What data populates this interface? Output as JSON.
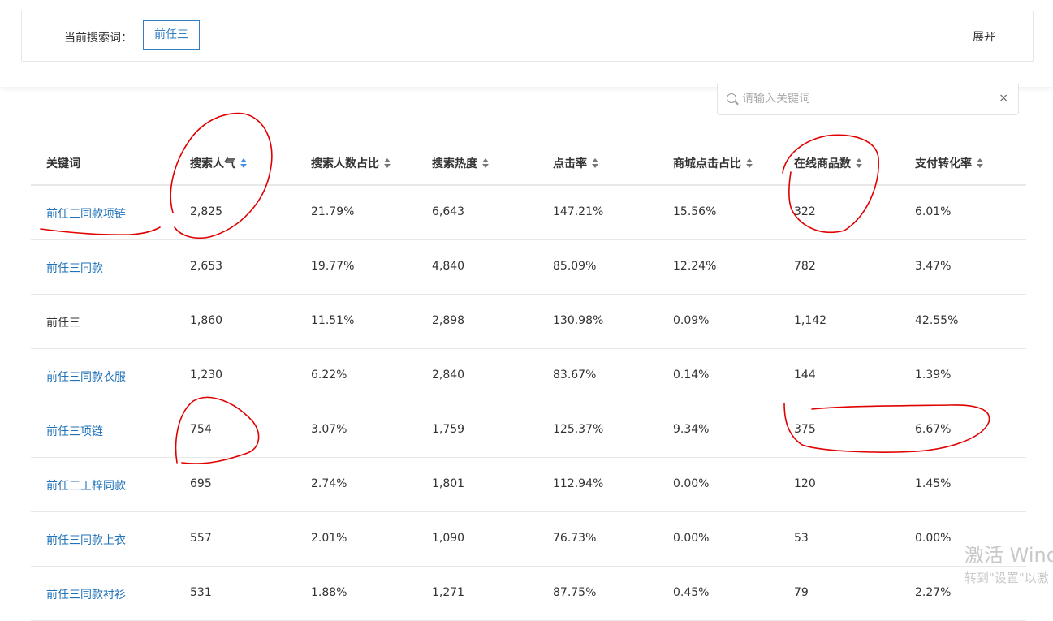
{
  "search_bar": {
    "label": "当前搜索词：",
    "term": "前任三",
    "expand_label": "展开"
  },
  "keyword_search": {
    "placeholder": "请输入关键词",
    "clear_label": "×"
  },
  "table": {
    "columns": [
      "关键词",
      "搜索人气",
      "搜索人数占比",
      "搜索热度",
      "点击率",
      "商城点击占比",
      "在线商品数",
      "支付转化率"
    ],
    "active_sort_column": "搜索人气",
    "rows": [
      [
        "前任三同款项链",
        "2,825",
        "21.79%",
        "6,643",
        "147.21%",
        "15.56%",
        "322",
        "6.01%"
      ],
      [
        "前任三同款",
        "2,653",
        "19.77%",
        "4,840",
        "85.09%",
        "12.24%",
        "782",
        "3.47%"
      ],
      [
        "前任三",
        "1,860",
        "11.51%",
        "2,898",
        "130.98%",
        "0.09%",
        "1,142",
        "42.55%"
      ],
      [
        "前任三同款衣服",
        "1,230",
        "6.22%",
        "2,840",
        "83.67%",
        "0.14%",
        "144",
        "1.39%"
      ],
      [
        "前任三项链",
        "754",
        "3.07%",
        "1,759",
        "125.37%",
        "9.34%",
        "375",
        "6.67%"
      ],
      [
        "前任三王梓同款",
        "695",
        "2.74%",
        "1,801",
        "112.94%",
        "0.00%",
        "120",
        "1.45%"
      ],
      [
        "前任三同款上衣",
        "557",
        "2.01%",
        "1,090",
        "76.73%",
        "0.00%",
        "53",
        "0.00%"
      ],
      [
        "前任三同款衬衫",
        "531",
        "1.88%",
        "1,271",
        "87.75%",
        "0.45%",
        "79",
        "2.27%"
      ]
    ]
  },
  "watermark": {
    "line1": "激活 Wind",
    "line2": "转到\"设置\"以激"
  },
  "colors": {
    "link": "#1f72b8",
    "accent": "#2f7fc1",
    "annotation": "#e00000"
  }
}
